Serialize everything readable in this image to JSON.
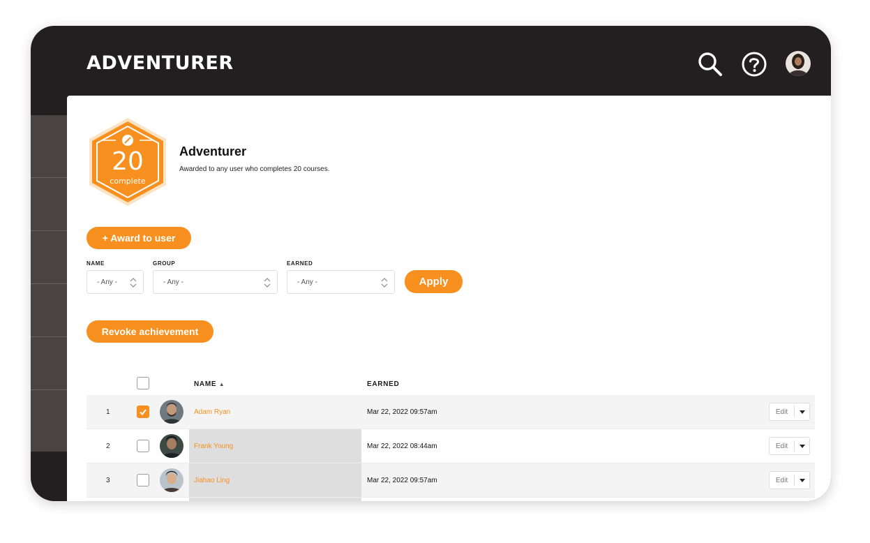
{
  "header": {
    "title": "ADVENTURER"
  },
  "achievement": {
    "badge_number": "20",
    "badge_caption": "complete",
    "title": "Adventurer",
    "description": "Awarded to any user who completes 20 courses."
  },
  "actions": {
    "award_label": "+ Award to user",
    "apply_label": "Apply",
    "revoke_label": "Revoke achievement"
  },
  "filters": {
    "name": {
      "label": "NAME",
      "value": "- Any -"
    },
    "group": {
      "label": "GROUP",
      "value": "- Any -"
    },
    "earned": {
      "label": "EARNED",
      "value": "- Any -"
    }
  },
  "table": {
    "columns": {
      "name": "NAME",
      "sort_indicator": "▲",
      "earned": "EARNED"
    },
    "rows": [
      {
        "index": "1",
        "name": "Adam Ryan",
        "earned": "Mar 22, 2022 09:57am",
        "checked": true,
        "edit": "Edit"
      },
      {
        "index": "2",
        "name": "Frank Young",
        "earned": "Mar 22, 2022 08:44am",
        "checked": false,
        "edit": "Edit"
      },
      {
        "index": "3",
        "name": "Jiahao Ling",
        "earned": "Mar 22, 2022 09:57am",
        "checked": false,
        "edit": "Edit"
      }
    ]
  },
  "colors": {
    "accent": "#f7901e",
    "topbar": "#231f20",
    "sidebar": "#4a4344"
  },
  "icons": [
    "search-icon",
    "help-icon",
    "user-avatar",
    "compass-icon",
    "checkmark-icon",
    "caret-down-icon",
    "select-arrows-icon"
  ]
}
